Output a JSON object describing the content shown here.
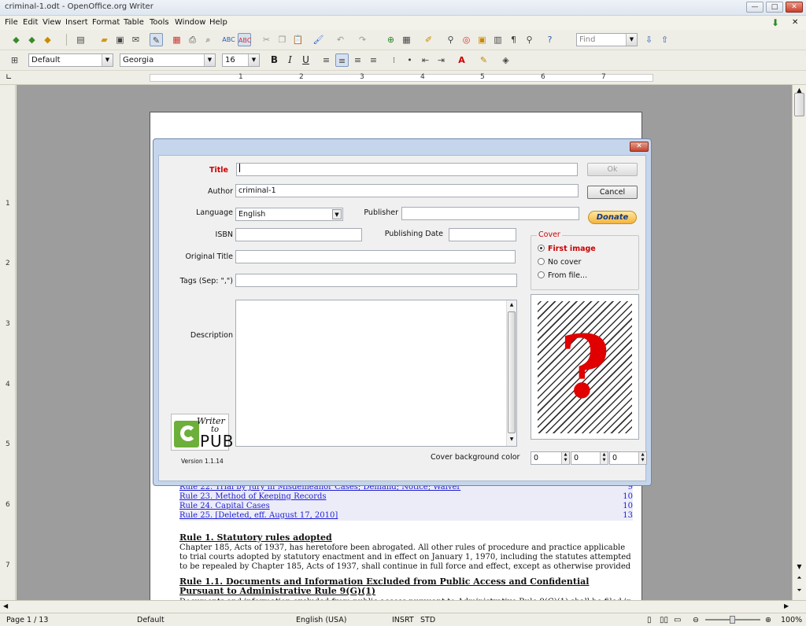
{
  "window": {
    "title": "criminal-1.odt - OpenOffice.org Writer",
    "min": "—",
    "max": "□",
    "close": "✕"
  },
  "menu": [
    "File",
    "Edit",
    "View",
    "Insert",
    "Format",
    "Table",
    "Tools",
    "Window",
    "Help"
  ],
  "toolbar": {
    "find_placeholder": "Find"
  },
  "format_bar": {
    "style": "Default",
    "font": "Georgia",
    "size": "16"
  },
  "ruler": {
    "numbers": [
      "1",
      "2",
      "3",
      "4",
      "5",
      "6",
      "7"
    ]
  },
  "vruler": {
    "numbers": [
      "1",
      "2",
      "3",
      "4",
      "5",
      "6",
      "7"
    ]
  },
  "document": {
    "toc": [
      {
        "text": "Rule 22. Trial by Jury in Misdemeanor Cases; Demand; Notice; Waiver",
        "page": "9"
      },
      {
        "text": "Rule 23. Method of Keeping Records",
        "page": "10"
      },
      {
        "text": "Rule 24. Capital Cases",
        "page": "10"
      },
      {
        "text": "Rule 25. [Deleted, eff. August 17, 2010]",
        "page": "13"
      }
    ],
    "heading1": "Rule 1. Statutory rules adopted",
    "para1": "Chapter 185, Acts of 1937, has heretofore been abrogated. All other rules of procedure and practice applicable to trial courts adopted by statutory enactment and in effect on January 1, 1970, including the statutes attempted to be repealed by Chapter 185, Acts of 1937, shall continue in full force and effect, except as otherwise provided by the rules of this court.",
    "heading2": "Rule 1.1. Documents and Information Excluded from Public Access and Confidential Pursuant to Administrative Rule 9(G)(1)",
    "para2": "Documents and information excluded from public access pursuant to Administrative Rule 9(G)(1) shall be filed in"
  },
  "dialog": {
    "title_label": "Title",
    "author_label": "Author",
    "author_value": "criminal-1",
    "language_label": "Language",
    "language_value": "English",
    "publisher_label": "Publisher",
    "isbn_label": "ISBN",
    "pubdate_label": "Publishing Date",
    "original_title_label": "Original Title",
    "tags_label": "Tags (Sep: \",\")",
    "description_label": "Description",
    "ok": "Ok",
    "cancel": "Cancel",
    "donate": "Donate",
    "cover_group": "Cover",
    "cover_options": [
      "First image",
      "No cover",
      "From file..."
    ],
    "cover_bg_label": "Cover background color",
    "cover_bg_values": [
      "0",
      "0",
      "0"
    ],
    "logo_top": "Writer",
    "logo_to": "to",
    "logo_bottom": "PUB",
    "version": "Version 1.1.14"
  },
  "status": {
    "page": "Page 1 / 13",
    "style": "Default",
    "language": "English (USA)",
    "insert": "INSRT",
    "selection": "STD",
    "zoom": "100%"
  },
  "colors": {
    "accent": "#1e1ed0",
    "title_red": "#cc0000",
    "cover_red": "#e00000"
  }
}
